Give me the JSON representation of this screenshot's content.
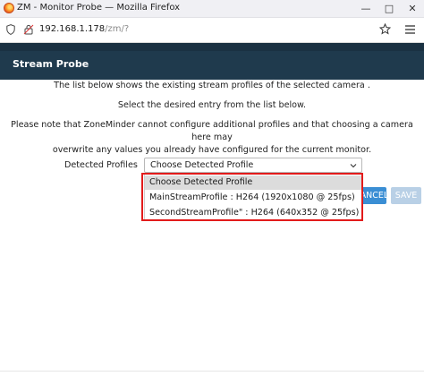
{
  "window": {
    "title": "ZM - Monitor Probe — Mozilla Firefox",
    "minimize": "—",
    "maximize": "□",
    "close": "✕"
  },
  "urlbar": {
    "host": "192.168.1.178",
    "path": "/zm/?"
  },
  "header": {
    "title": "Stream Probe"
  },
  "body": {
    "line1": "The list below shows the existing stream profiles of the selected camera .",
    "line2": "Select the desired entry from the list below.",
    "line3a": "Please note that ZoneMinder cannot configure additional profiles and that choosing a camera here may",
    "line3b": "overwrite any values you already have configured for the current monitor."
  },
  "form": {
    "label": "Detected Profiles",
    "selected": "Choose Detected Profile",
    "options": [
      "Choose Detected Profile",
      "MainStreamProfile : H264 (1920x1080 @ 25fps)",
      "SecondStreamProfile\" : H264 (640x352 @ 25fps)"
    ]
  },
  "buttons": {
    "cancel": "CANCEL",
    "save": "SAVE"
  },
  "colors": {
    "header": "#1f3a4d",
    "highlight": "#e21b1b",
    "primary": "#3a8ed4"
  },
  "icons": [
    "firefox-logo-icon",
    "shield-icon",
    "lock-icon",
    "star-icon",
    "menu-icon",
    "chevron-down-icon"
  ]
}
